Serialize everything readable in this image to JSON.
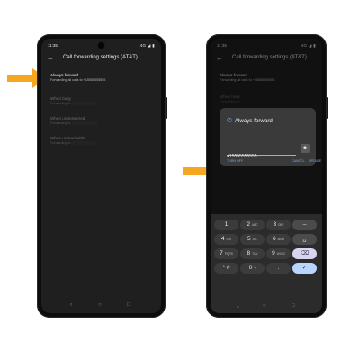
{
  "colors": {
    "arrow": "#f5a623",
    "accent": "#7fb2ff",
    "phone_screen": "#1f1f1f"
  },
  "left_screen": {
    "status_time": "11:35",
    "status_icons": "4G ◢ ▮",
    "title": "Call forwarding settings (AT&T)",
    "back_icon": "arrow-back-icon",
    "items": [
      {
        "title": "Always forward",
        "subtitle": "Forwarding all calls to +15555555555"
      },
      {
        "title": "When busy",
        "subtitle": "Forwarding to"
      },
      {
        "title": "When unanswered",
        "subtitle": "Forwarding to"
      },
      {
        "title": "When unreachable",
        "subtitle": "Forwarding to"
      }
    ],
    "nav": {
      "back": "‹",
      "home": "○",
      "recents": "□"
    }
  },
  "right_screen": {
    "status_time": "11:35",
    "status_icons": "4G ◢ ▮",
    "title": "Call forwarding settings (AT&T)",
    "background_items": [
      {
        "title": "Always forward",
        "subtitle": "Forwarding all calls to +15555555555"
      },
      {
        "title": "When busy",
        "subtitle": "Forwarding to"
      }
    ],
    "dialog": {
      "title": "Always forward",
      "phone_icon": "phone-forward-icon",
      "number_value": "+15555555555",
      "number_placeholder": "Number",
      "contact_icon": "contact-icon",
      "actions": {
        "turn_off": "TURN OFF",
        "cancel": "CANCEL",
        "update": "UPDATE"
      }
    },
    "keypad": [
      {
        "main": "1",
        "sub": ""
      },
      {
        "main": "2",
        "sub": "ABC"
      },
      {
        "main": "3",
        "sub": "DEF"
      },
      {
        "main": "–",
        "sub": ""
      },
      {
        "main": "4",
        "sub": "GHI"
      },
      {
        "main": "5",
        "sub": "JKL"
      },
      {
        "main": "6",
        "sub": "MNO"
      },
      {
        "main": "␣",
        "sub": ""
      },
      {
        "main": "7",
        "sub": "PQRS"
      },
      {
        "main": "8",
        "sub": "TUV"
      },
      {
        "main": "9",
        "sub": "WXYZ"
      },
      {
        "main": "⌫",
        "sub": ""
      },
      {
        "main": "* #",
        "sub": ""
      },
      {
        "main": "0",
        "sub": "+"
      },
      {
        "main": ".",
        "sub": ""
      },
      {
        "main": "✓",
        "sub": ""
      }
    ],
    "nav": {
      "back": "⌄",
      "home": "○",
      "recents": "□"
    }
  }
}
